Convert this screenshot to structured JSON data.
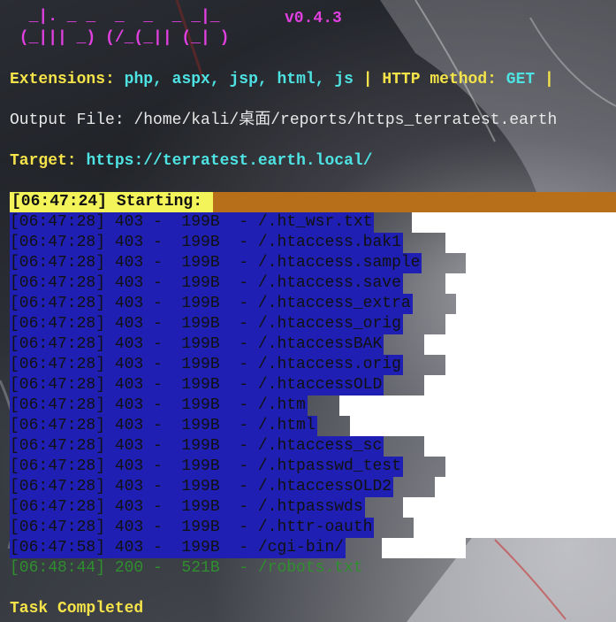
{
  "banner": {
    "line1": "  _|. _ _  _  _  _ _|_   ",
    "line2": " (_||| _) (/_(_|| (_| )  ",
    "version": "v0.4.3"
  },
  "config": {
    "ext_label": "Extensions:",
    "ext_values": "php, aspx, jsp, html, js",
    "sep": "|",
    "method_label": "HTTP method:",
    "method_value": "GET",
    "sep2": "|"
  },
  "output": {
    "label": "Output File:",
    "path": "/home/kali/桌面/reports/https_terratest.earth"
  },
  "target": {
    "label": "Target:",
    "url": "https://terratest.earth.local/"
  },
  "start": {
    "label": "[06:47:24] Starting:"
  },
  "results": [
    {
      "text": "[06:47:28] 403 -  199B  - /.ht_wsr.txt"
    },
    {
      "text": "[06:47:28] 403 -  199B  - /.htaccess.bak1"
    },
    {
      "text": "[06:47:28] 403 -  199B  - /.htaccess.sample"
    },
    {
      "text": "[06:47:28] 403 -  199B  - /.htaccess.save"
    },
    {
      "text": "[06:47:28] 403 -  199B  - /.htaccess_extra"
    },
    {
      "text": "[06:47:28] 403 -  199B  - /.htaccess_orig"
    },
    {
      "text": "[06:47:28] 403 -  199B  - /.htaccessBAK"
    },
    {
      "text": "[06:47:28] 403 -  199B  - /.htaccess.orig"
    },
    {
      "text": "[06:47:28] 403 -  199B  - /.htaccessOLD"
    },
    {
      "text": "[06:47:28] 403 -  199B  - /.htm"
    },
    {
      "text": "[06:47:28] 403 -  199B  - /.html"
    },
    {
      "text": "[06:47:28] 403 -  199B  - /.htaccess_sc"
    },
    {
      "text": "[06:47:28] 403 -  199B  - /.htpasswd_test"
    },
    {
      "text": "[06:47:28] 403 -  199B  - /.htaccessOLD2"
    },
    {
      "text": "[06:47:28] 403 -  199B  - /.htpasswds"
    },
    {
      "text": "[06:47:28] 403 -  199B  - /.httr-oauth"
    },
    {
      "text": "[06:47:58] 403 -  199B  - /cgi-bin/"
    }
  ],
  "found": {
    "text": "[06:48:44] 200 -  521B  - /robots.txt"
  },
  "footer": {
    "status": "Task Completed"
  },
  "colors": {
    "banner": "#e040e0",
    "label": "#f5e34a",
    "value": "#4ee3e3",
    "highlight_bg": "#1f1fb3",
    "start_bar": "#b86f1a",
    "start_label_bg": "#f3f35a"
  }
}
